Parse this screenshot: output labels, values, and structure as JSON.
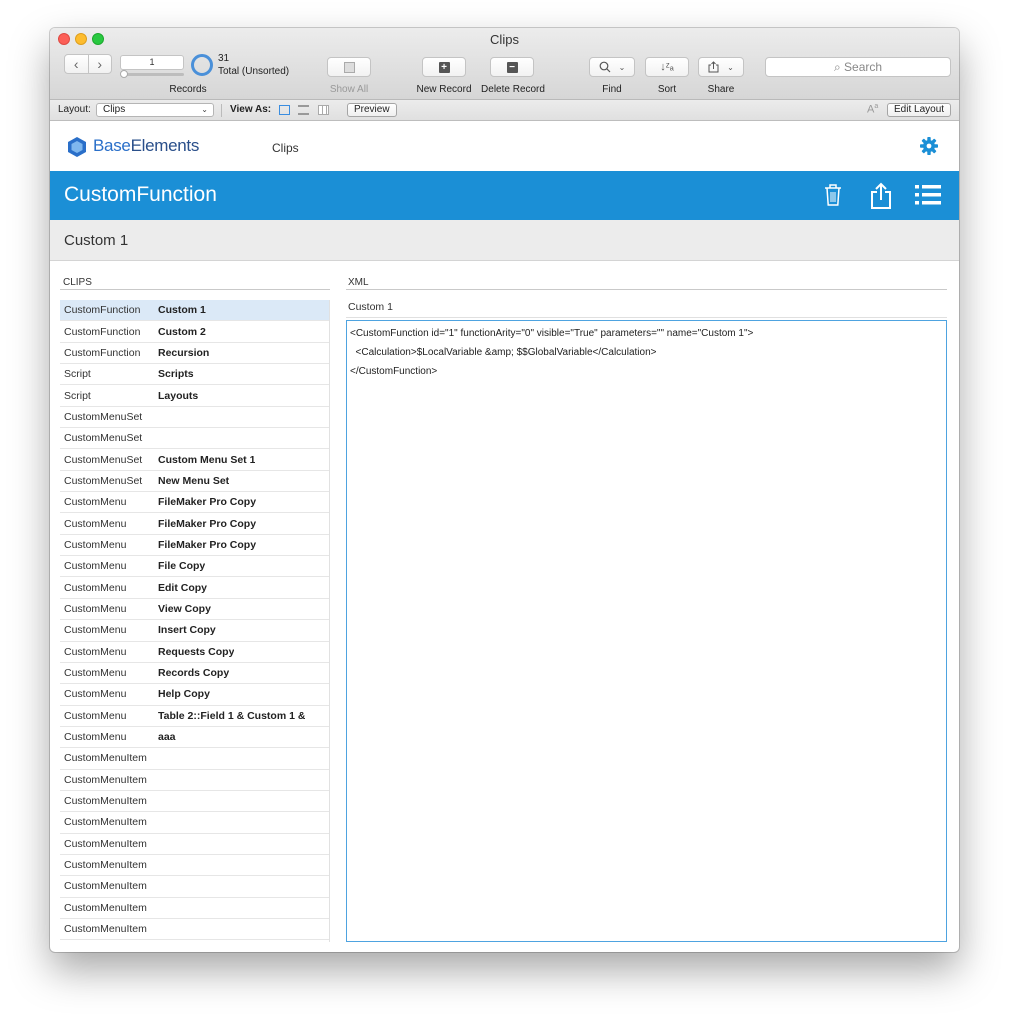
{
  "window": {
    "title": "Clips"
  },
  "toolbar": {
    "record_number": "1",
    "total_count": "31",
    "total_label": "Total (Unsorted)",
    "records_label": "Records",
    "show_all_label": "Show All",
    "new_record_label": "New Record",
    "delete_record_label": "Delete Record",
    "find_label": "Find",
    "sort_label": "Sort",
    "share_label": "Share",
    "search_placeholder": "Search"
  },
  "layout_bar": {
    "layout_label": "Layout:",
    "layout_value": "Clips",
    "view_as_label": "View As:",
    "preview_label": "Preview",
    "aa_label": "A",
    "edit_layout_label": "Edit Layout"
  },
  "header": {
    "logo_prefix": "Base",
    "logo_suffix": "Elements",
    "section": "Clips"
  },
  "bluebar": {
    "title": "CustomFunction"
  },
  "record": {
    "title": "Custom 1"
  },
  "clips": {
    "heading": "CLIPS",
    "rows": [
      {
        "type": "CustomFunction",
        "name": "Custom 1"
      },
      {
        "type": "CustomFunction",
        "name": "Custom 2"
      },
      {
        "type": "CustomFunction",
        "name": "Recursion"
      },
      {
        "type": "Script",
        "name": "Scripts"
      },
      {
        "type": "Script",
        "name": "Layouts"
      },
      {
        "type": "CustomMenuSet",
        "name": ""
      },
      {
        "type": "CustomMenuSet",
        "name": ""
      },
      {
        "type": "CustomMenuSet",
        "name": "Custom Menu Set 1"
      },
      {
        "type": "CustomMenuSet",
        "name": "New Menu Set"
      },
      {
        "type": "CustomMenu",
        "name": "FileMaker Pro Copy"
      },
      {
        "type": "CustomMenu",
        "name": "FileMaker Pro Copy"
      },
      {
        "type": "CustomMenu",
        "name": "FileMaker Pro Copy"
      },
      {
        "type": "CustomMenu",
        "name": "File Copy"
      },
      {
        "type": "CustomMenu",
        "name": "Edit Copy"
      },
      {
        "type": "CustomMenu",
        "name": "View Copy"
      },
      {
        "type": "CustomMenu",
        "name": "Insert Copy"
      },
      {
        "type": "CustomMenu",
        "name": "Requests Copy"
      },
      {
        "type": "CustomMenu",
        "name": "Records Copy"
      },
      {
        "type": "CustomMenu",
        "name": "Help Copy"
      },
      {
        "type": "CustomMenu",
        "name": "Table 2::Field 1 & Custom 1 &"
      },
      {
        "type": "CustomMenu",
        "name": "aaa"
      },
      {
        "type": "CustomMenuItem",
        "name": ""
      },
      {
        "type": "CustomMenuItem",
        "name": ""
      },
      {
        "type": "CustomMenuItem",
        "name": ""
      },
      {
        "type": "CustomMenuItem",
        "name": ""
      },
      {
        "type": "CustomMenuItem",
        "name": ""
      },
      {
        "type": "CustomMenuItem",
        "name": ""
      },
      {
        "type": "CustomMenuItem",
        "name": ""
      },
      {
        "type": "CustomMenuItem",
        "name": ""
      },
      {
        "type": "CustomMenuItem",
        "name": ""
      }
    ]
  },
  "xml": {
    "heading": "XML",
    "name": "Custom 1",
    "lines": [
      "<CustomFunction id=\"1\" functionArity=\"0\" visible=\"True\" parameters=\"\" name=\"Custom 1\">",
      "  <Calculation>$LocalVariable &amp; $$GlobalVariable</Calculation>",
      "</CustomFunction>"
    ]
  },
  "colors": {
    "accent": "#1b8fd6",
    "selected_row": "#dbe9f7"
  }
}
